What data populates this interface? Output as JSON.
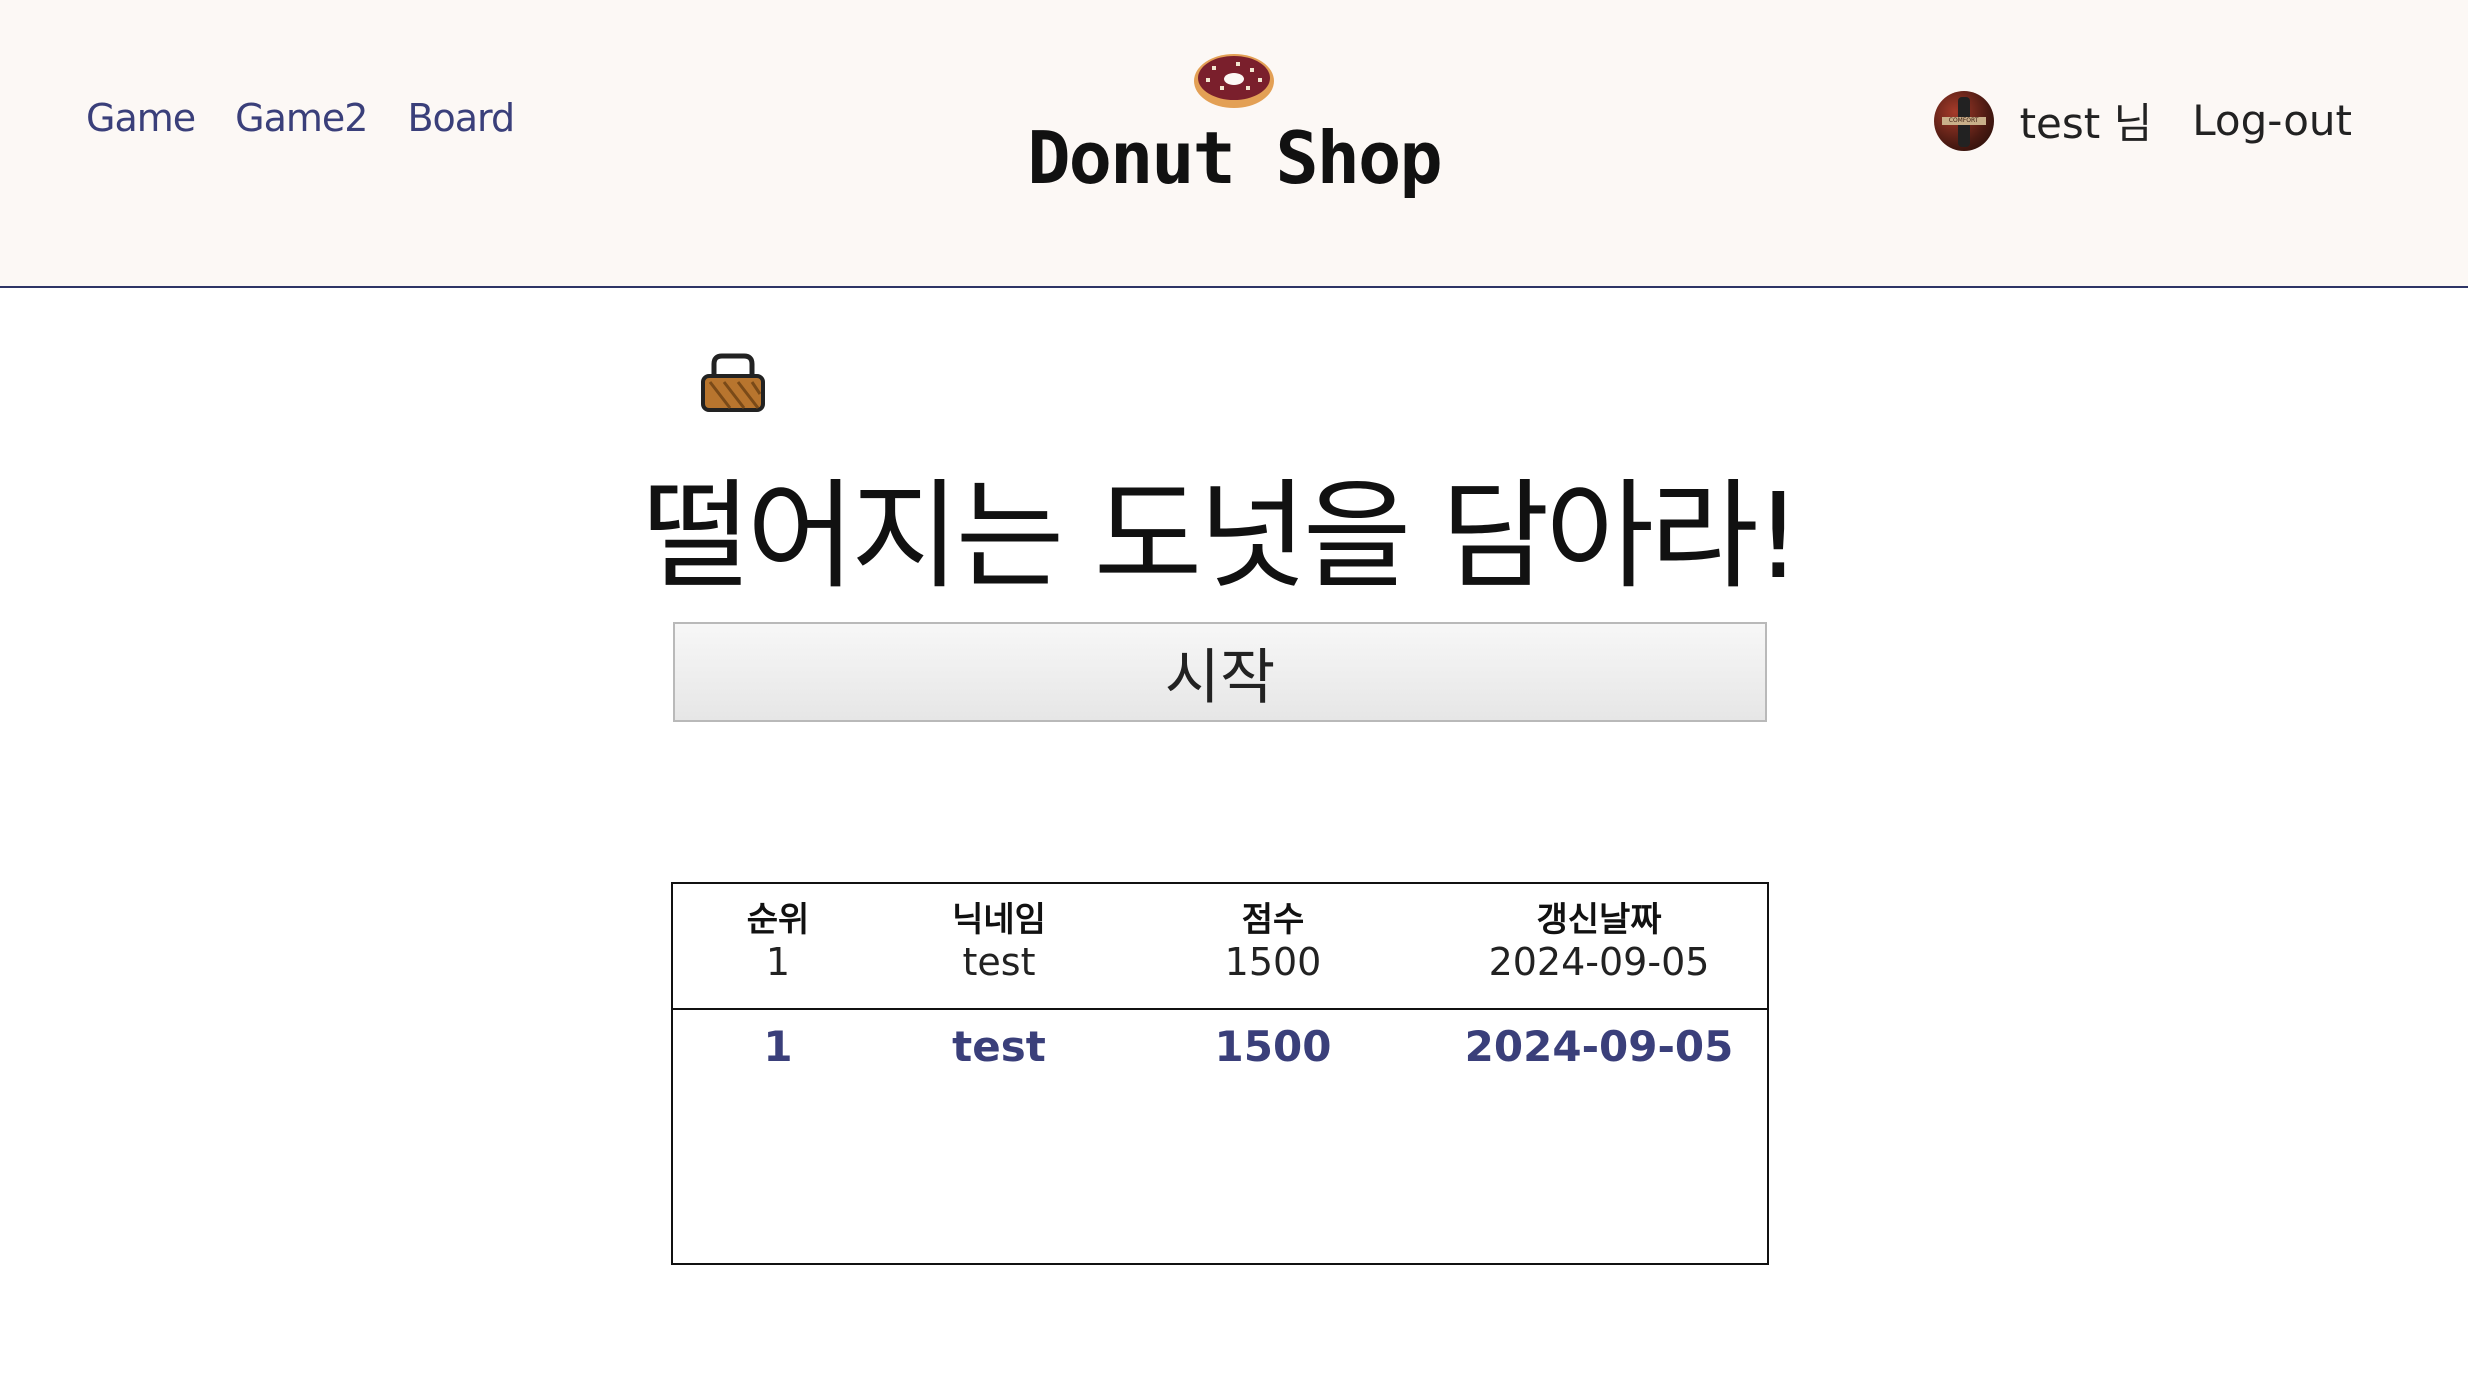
{
  "nav": {
    "items": [
      "Game",
      "Game2",
      "Board"
    ]
  },
  "brand": {
    "title": "Donut Shop",
    "icon": "donut-icon"
  },
  "user": {
    "name": "test 님",
    "logout": "Log-out",
    "avatar_icon": "avatar-image"
  },
  "game": {
    "basket_icon": "basket-icon",
    "title": "떨어지는 도넛을 담아라!",
    "start_label": "시작"
  },
  "ranking": {
    "headers": [
      "순위",
      "닉네임",
      "점수",
      "갱신날짜"
    ],
    "rows": [
      [
        "1",
        "test",
        "1500",
        "2024-09-05"
      ]
    ],
    "my_record": [
      "1",
      "test",
      "1500",
      "2024-09-05"
    ]
  },
  "colors": {
    "header_bg": "#fcf8f5",
    "accent": "#3a3f7a",
    "divider": "#2e3566"
  }
}
